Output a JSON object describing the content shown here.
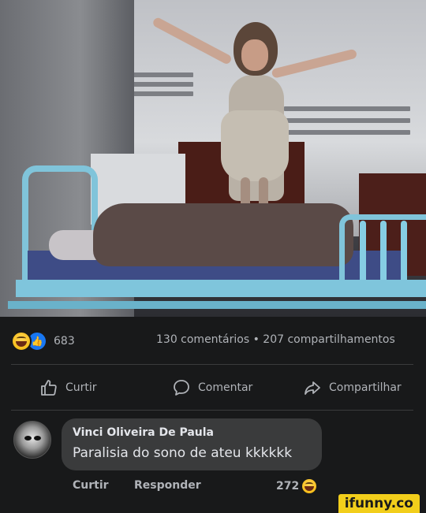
{
  "post": {
    "reactions_count": "683",
    "stats_text": "130 comentários • 207 compartilhamentos"
  },
  "actions": {
    "like_label": "Curtir",
    "comment_label": "Comentar",
    "share_label": "Compartilhar"
  },
  "comment": {
    "author": "Vinci Oliveira De Paula",
    "text": "Paralisia do sono de ateu kkkkkk",
    "like_label": "Curtir",
    "reply_label": "Responder",
    "reaction_count": "272"
  },
  "watermark": "ifunny.co",
  "colors": {
    "background": "#18191a",
    "bubble": "#3a3b3c",
    "like_blue": "#1877f2",
    "haha_yellow": "#f4b400",
    "watermark_yellow": "#f2ce1b"
  }
}
